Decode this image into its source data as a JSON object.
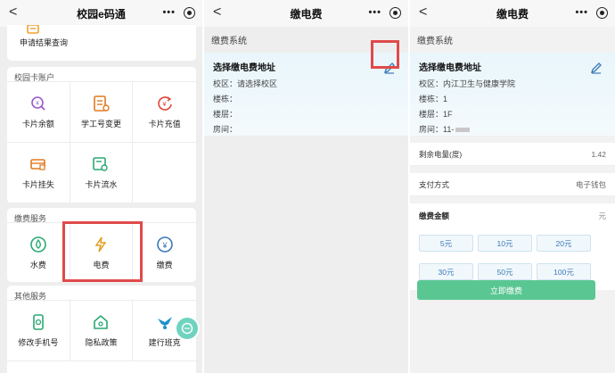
{
  "panel1": {
    "title": "校园e码通",
    "more": "•••",
    "back": "<",
    "top_item_label": "申请结果查询",
    "sections": [
      {
        "title": "校园卡账户",
        "items": [
          "卡片余额",
          "学工号变更",
          "卡片充值",
          "卡片挂失",
          "卡片流水"
        ]
      },
      {
        "title": "缴费服务",
        "items": [
          "水费",
          "电费",
          "缴费"
        ]
      },
      {
        "title": "其他服务",
        "items": [
          "修改手机号",
          "隐私政策",
          "建行班克"
        ]
      }
    ]
  },
  "panel2": {
    "title": "缴电费",
    "back": "<",
    "more": "•••",
    "section": "缴费系统",
    "addr_title": "选择缴电费地址",
    "campus": "校区：请选择校区",
    "building": "楼栋：",
    "floor": "楼层：",
    "room": "房间："
  },
  "panel3": {
    "title": "缴电费",
    "back": "<",
    "more": "•••",
    "section": "缴费系统",
    "addr_title": "选择缴电费地址",
    "campus": "校区：内江卫生与健康学院",
    "building": "楼栋：1",
    "floor": "楼层：1F",
    "room": "房间：11-",
    "remain_label": "剩余电量(度)",
    "remain_value": "1.42",
    "pay_method_label": "支付方式",
    "pay_method_value": "电子钱包",
    "amount_label": "缴费金额",
    "amount_unit": "元",
    "amounts": [
      "5元",
      "10元",
      "20元",
      "30元",
      "50元",
      "100元"
    ],
    "pay_button": "立即缴费"
  },
  "colors": {
    "highlight": "#e04a4a",
    "accent_green": "#5ac792",
    "link_blue": "#3a78b6"
  }
}
